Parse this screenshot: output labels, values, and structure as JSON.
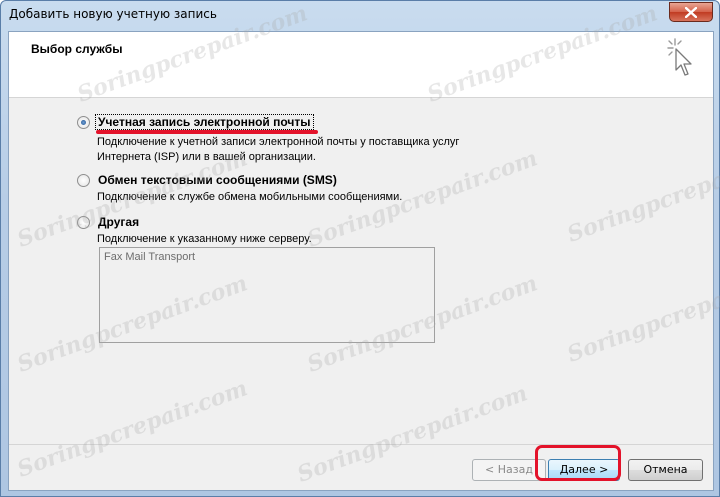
{
  "window": {
    "title": "Добавить новую учетную запись"
  },
  "header": {
    "title": "Выбор службы"
  },
  "options": [
    {
      "label": "Учетная запись электронной почты",
      "description": "Подключение к учетной записи электронной почты у поставщика услуг Интернета (ISP) или в вашей организации.",
      "selected": true
    },
    {
      "label": "Обмен текстовыми сообщениями (SMS)",
      "description": "Подключение к службе обмена мобильными сообщениями.",
      "selected": false
    },
    {
      "label": "Другая",
      "description": "Подключение к указанному ниже серверу.",
      "selected": false
    }
  ],
  "server_list": {
    "items": [
      "Fax Mail Transport"
    ]
  },
  "buttons": {
    "back": "< Назад",
    "next": "Далее >",
    "cancel": "Отмена"
  },
  "watermark": "Soringpcrepair.com",
  "colors": {
    "annotation_red": "#e3122a",
    "title_bar": "#b7cde6"
  }
}
